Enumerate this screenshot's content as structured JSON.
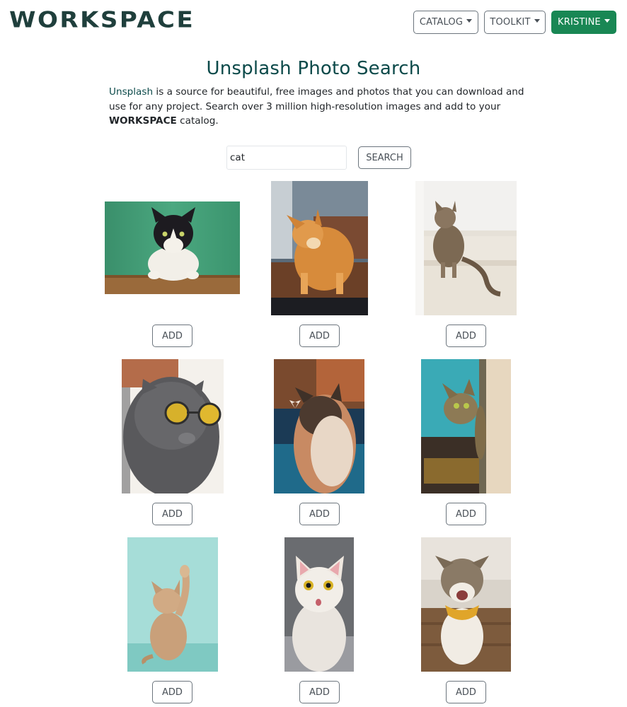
{
  "header": {
    "brand": "WORKSPACE",
    "menus": [
      {
        "label": "CATALOG"
      },
      {
        "label": "TOOLKIT"
      },
      {
        "label": "KRISTINE"
      }
    ],
    "accent_color": "#198754"
  },
  "intro": {
    "title": "Unsplash Photo Search",
    "link_text": "Unsplash",
    "text_after_link": " is a source for beautiful, free images and photos that you can download and use for any project. Search over 3 million high-resolution images and add to your ",
    "brand_inline": "WORKSPACE",
    "text_end": " catalog."
  },
  "search": {
    "value": "cat",
    "button_label": "SEARCH"
  },
  "results": [
    {
      "image": "cat-photo-green-wall",
      "button_label": "ADD"
    },
    {
      "image": "cat-photo-ginger-longhair",
      "button_label": "ADD"
    },
    {
      "image": "cat-photo-tabby-stairs",
      "button_label": "ADD"
    },
    {
      "image": "cat-photo-grey-sunglasses",
      "button_label": "ADD"
    },
    {
      "image": "cat-photo-butterfly-nose",
      "button_label": "ADD"
    },
    {
      "image": "cat-photo-peeking-tabby",
      "button_label": "ADD"
    },
    {
      "image": "cat-photo-paw-raised-teal",
      "button_label": "ADD"
    },
    {
      "image": "cat-photo-white-surprised",
      "button_label": "ADD"
    },
    {
      "image": "cat-photo-happy-scarf",
      "button_label": "ADD"
    }
  ]
}
